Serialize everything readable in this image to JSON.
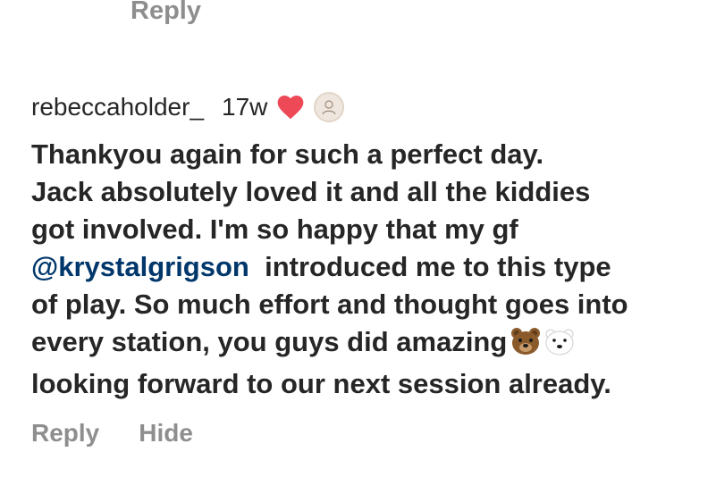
{
  "top_reply_label": "Reply",
  "comment": {
    "username": "rebeccaholder_",
    "time": "17w",
    "heart_color": "#ed4956",
    "lines": [
      "Thankyou again for such a perfect day.",
      "Jack absolutely  loved it and all the kiddies",
      "got involved. I'm so happy that my gf",
      "introduced me to this type",
      "of play. So much effort and thought goes into",
      "every station, you guys did amazing",
      "looking forward to our next session already."
    ],
    "mention": "@krystalgrigson",
    "emojis": [
      "bear-emoji",
      "polar-bear-emoji"
    ],
    "reply_label": "Reply",
    "hide_label": "Hide"
  }
}
